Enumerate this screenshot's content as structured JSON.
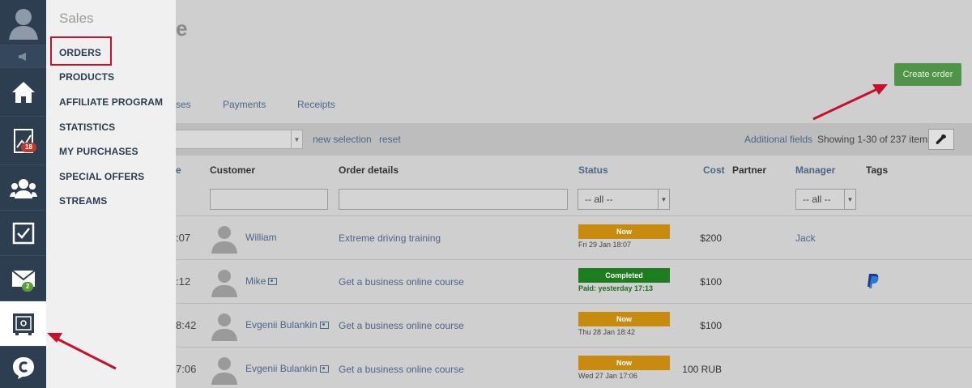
{
  "rail": {
    "mail_badge": "2",
    "chart_badge": "18"
  },
  "menu": {
    "title": "Sales",
    "items": [
      {
        "label": "ORDERS"
      },
      {
        "label": "PRODUCTS"
      },
      {
        "label": "AFFILIATE PROGRAM"
      },
      {
        "label": "STATISTICS"
      },
      {
        "label": "MY PURCHASES"
      },
      {
        "label": "SPECIAL OFFERS"
      },
      {
        "label": "STREAMS"
      }
    ]
  },
  "header": {
    "title_fragment": "e",
    "create_button": "Create order"
  },
  "tabs": [
    {
      "label": "ses"
    },
    {
      "label": "Payments"
    },
    {
      "label": "Receipts"
    }
  ],
  "toolbar": {
    "new_selection": "new selection",
    "reset": "reset",
    "additional_fields": "Additional fields",
    "showing": "Showing 1-30 of 237 items."
  },
  "columns": {
    "date_fragment": "e",
    "customer": "Customer",
    "order_details": "Order details",
    "status": "Status",
    "cost": "Cost",
    "partner": "Partner",
    "manager": "Manager",
    "tags": "Tags"
  },
  "filters": {
    "status_value": "-- all --",
    "manager_value": "-- all --"
  },
  "rows": [
    {
      "time": ":07",
      "customer": "William",
      "order": "Extreme driving training",
      "status": "Now",
      "status_sub": "Fri 29 Jan 18:07",
      "cost": "$200",
      "manager": "Jack"
    },
    {
      "time": ":12",
      "customer": "Mike",
      "order": "Get a business online course",
      "status": "Completed",
      "status_sub": "Paid: yesterday 17:13",
      "cost": "$100",
      "manager": ""
    },
    {
      "time": "8:42",
      "customer": "Evgenii Bulankin",
      "order": "Get a business online course",
      "status": "Now",
      "status_sub": "Thu 28 Jan 18:42",
      "cost": "$100",
      "manager": ""
    },
    {
      "time": "7:06",
      "customer": "Evgenii Bulankin",
      "order": "Get a business online course",
      "status": "Now",
      "status_sub": "Wed 27 Jan 17:06",
      "cost": "100 RUB",
      "manager": ""
    }
  ],
  "colors": {
    "status_new": "#c98a10",
    "status_completed": "#1e7d1e",
    "annotation_arrow": "#c8102e",
    "rail_bg": "#2d3e50"
  }
}
